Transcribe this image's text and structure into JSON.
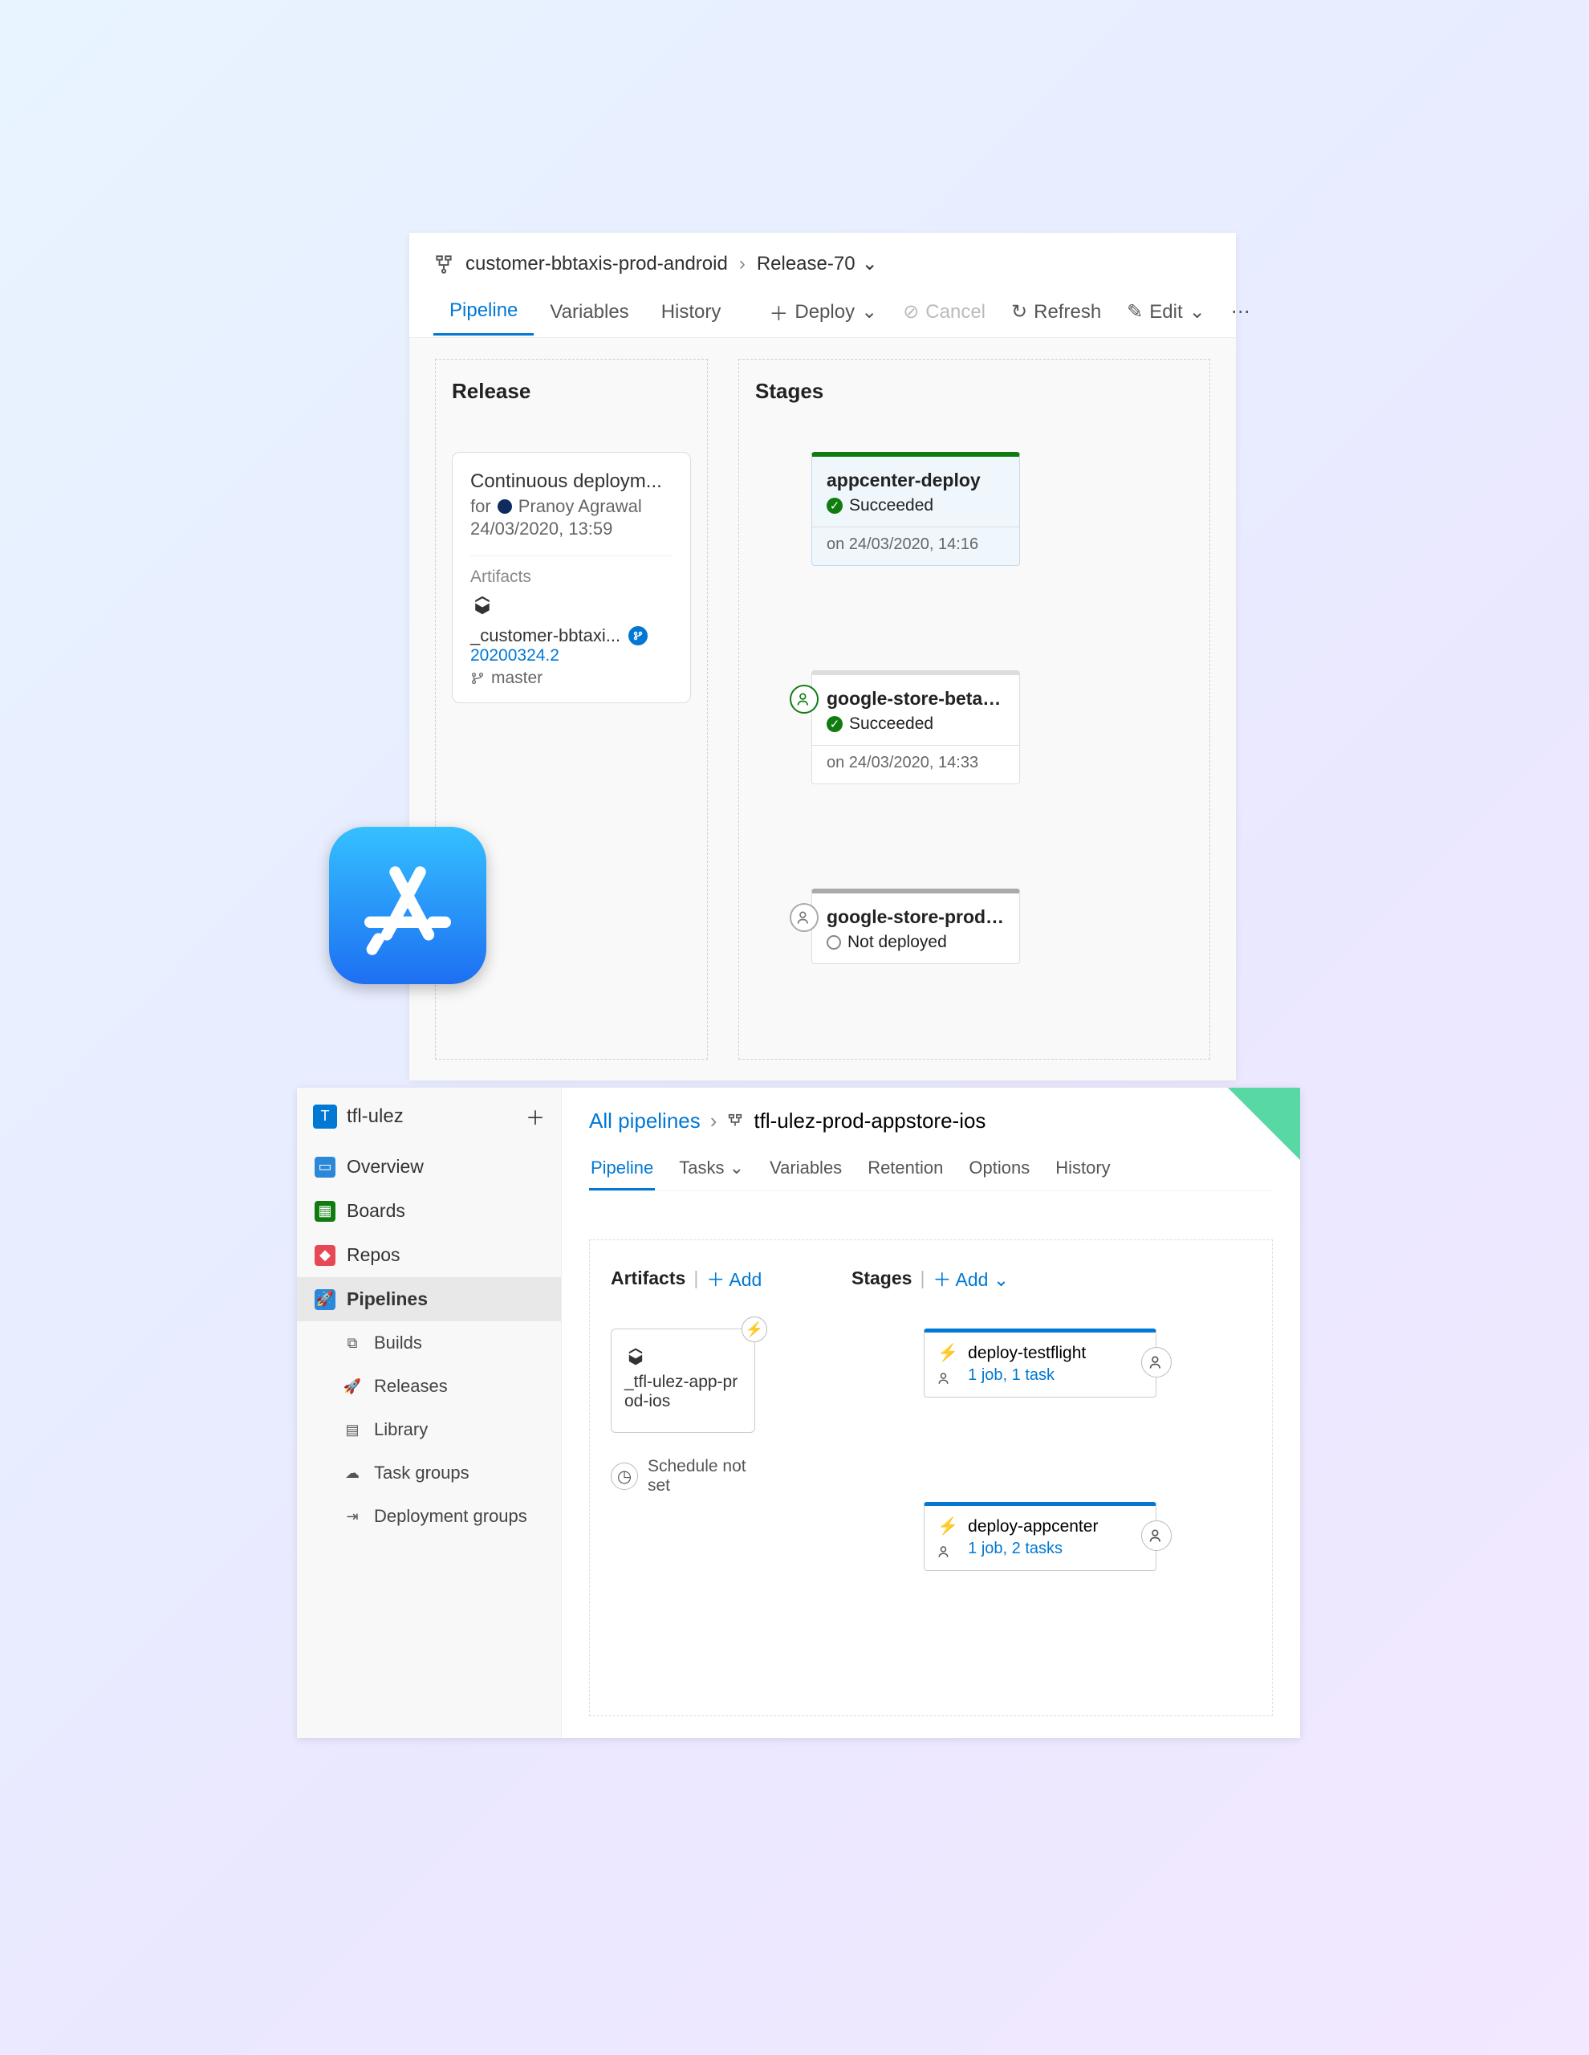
{
  "top": {
    "breadcrumb": {
      "project": "customer-bbtaxis-prod-android",
      "release": "Release-70"
    },
    "tabs": {
      "pipeline": "Pipeline",
      "variables": "Variables",
      "history": "History"
    },
    "toolbar": {
      "deploy": "Deploy",
      "cancel": "Cancel",
      "refresh": "Refresh",
      "edit": "Edit"
    },
    "release_column_title": "Release",
    "stages_column_title": "Stages",
    "release_card": {
      "trigger": "Continuous deploym...",
      "for_label": "for",
      "author": "Pranoy Agrawal",
      "datetime": "24/03/2020, 13:59",
      "artifacts_label": "Artifacts",
      "artifact_name": "_customer-bbtaxi...",
      "build_number": "20200324.2",
      "branch": "master"
    },
    "stages": [
      {
        "name": "appcenter-deploy",
        "status": "Succeeded",
        "on_label": "on 24/03/2020, 14:16",
        "status_type": "succeeded",
        "has_pre_icon": false
      },
      {
        "name": "google-store-beta-de",
        "status": "Succeeded",
        "on_label": "on 24/03/2020, 14:33",
        "status_type": "succeeded",
        "has_pre_icon": true,
        "pre_icon_green": true
      },
      {
        "name": "google-store-produc",
        "status": "Not deployed",
        "on_label": "",
        "status_type": "notdeployed",
        "has_pre_icon": true,
        "pre_icon_green": false
      }
    ]
  },
  "bottom": {
    "sidebar": {
      "project": "tfl-ulez",
      "items": {
        "overview": "Overview",
        "boards": "Boards",
        "repos": "Repos",
        "pipelines": "Pipelines",
        "builds": "Builds",
        "releases": "Releases",
        "library": "Library",
        "task_groups": "Task groups",
        "deployment_groups": "Deployment groups"
      }
    },
    "breadcrumb": {
      "all": "All pipelines",
      "current": "tfl-ulez-prod-appstore-ios"
    },
    "tabs": {
      "pipeline": "Pipeline",
      "tasks": "Tasks",
      "variables": "Variables",
      "retention": "Retention",
      "options": "Options",
      "history": "History"
    },
    "editor": {
      "artifacts_title": "Artifacts",
      "stages_title": "Stages",
      "add_label": "Add",
      "artifact_name": "_tfl-ulez-app-prod-ios",
      "schedule": "Schedule not set",
      "stages": [
        {
          "name": "deploy-testflight",
          "jobs": "1 job, 1 task"
        },
        {
          "name": "deploy-appcenter",
          "jobs": "1 job, 2 tasks"
        }
      ]
    }
  }
}
